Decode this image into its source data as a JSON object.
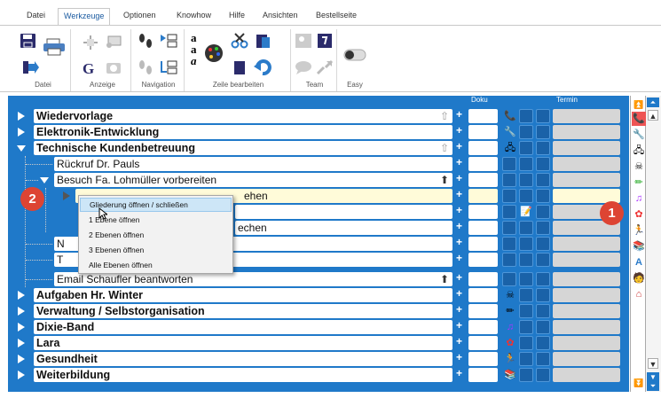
{
  "menu": {
    "tabs": [
      "Datei",
      "Werkzeuge",
      "Optionen",
      "Knowhow",
      "Hilfe",
      "Ansichten",
      "Bestellseite"
    ],
    "active": "Werkzeuge"
  },
  "ribbon": {
    "groups": [
      "Datei",
      "Anzeige",
      "Navigation",
      "Zeile bearbeiten",
      "Team",
      "Easy"
    ]
  },
  "table": {
    "col_doku": "Doku",
    "col_termin": "Termin",
    "rows": [
      {
        "label": "Wiedervorlage",
        "icon": "phone-icon"
      },
      {
        "label": "Elektronik-Entwicklung",
        "icon": "wrench-icon"
      },
      {
        "label": "Technische Kundenbetreuung",
        "icon": "network-icon"
      },
      {
        "label": "Rückruf Dr. Pauls",
        "icon": ""
      },
      {
        "label": "Besuch Fa. Lohmüller vorbereiten",
        "icon": ""
      },
      {
        "label": "Angebot mit ... besprechen",
        "visible_text": "ehen",
        "icon": ""
      },
      {
        "label": "",
        "icon": "folder-pencil-icon"
      },
      {
        "label": "",
        "visible_text": "echen",
        "icon": ""
      },
      {
        "label": "N",
        "icon": ""
      },
      {
        "label": "T",
        "icon": ""
      },
      {
        "label": "Email Schaufler beantworten",
        "icon": ""
      },
      {
        "label": "Aufgaben Hr. Winter",
        "icon": "skull-icon"
      },
      {
        "label": "Verwaltung / Selbstorganisation",
        "icon": "pencil-book-icon"
      },
      {
        "label": "Dixie-Band",
        "icon": "music-icon"
      },
      {
        "label": "Lara",
        "icon": "flower-icon"
      },
      {
        "label": "Gesundheit",
        "icon": "running-icon"
      },
      {
        "label": "Weiterbildung",
        "icon": "books-icon"
      }
    ]
  },
  "context_menu": {
    "items": [
      "Gliederung öffnen / schließen",
      "1 Ebene öffnen",
      "2 Ebenen öffnen",
      "3 Ebenen öffnen",
      "Alle Ebenen öffnen"
    ]
  },
  "badges": {
    "one": "1",
    "two": "2"
  },
  "right_toolbar": {
    "icons": [
      "phone-icon",
      "wrench-icon",
      "network-icon",
      "skull-icon",
      "pencil-book-icon",
      "music-icon",
      "flower-icon",
      "running-icon",
      "books-icon",
      "letter-a-icon",
      "person-icon",
      "house-icon"
    ]
  }
}
